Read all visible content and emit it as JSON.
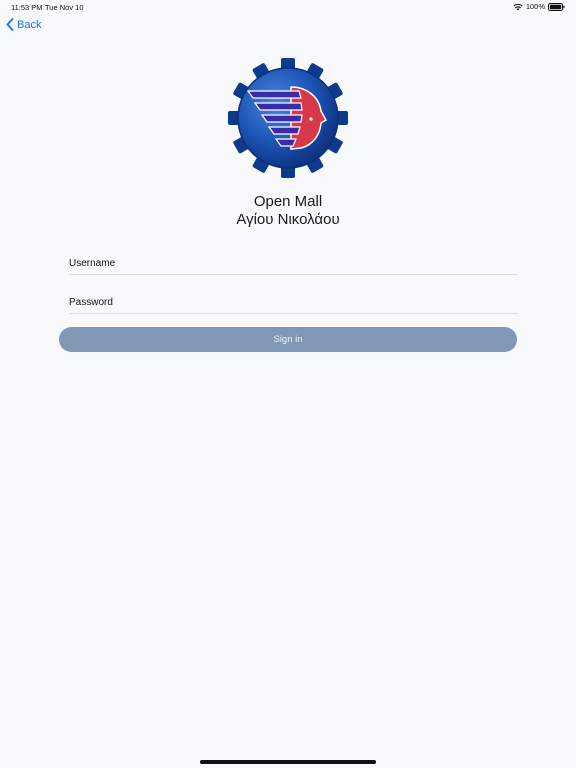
{
  "status_bar": {
    "time": "11:53 PM",
    "date": "Tue Nov 10",
    "battery": "100%",
    "icons": [
      "wifi-icon",
      "battery-icon"
    ]
  },
  "nav": {
    "back_label": "Back",
    "back_icon": "chevron-left-icon"
  },
  "logo": {
    "icon": "gear-logo-icon",
    "colors": {
      "gear": "#1d56b6",
      "wing": "#3d2aa8",
      "face": "#d8394a"
    }
  },
  "app_title": {
    "line1": "Open Mall",
    "line2": "Αγίου Νικολάου"
  },
  "form": {
    "username_placeholder": "Username",
    "password_placeholder": "Password",
    "signin_label": "Sign in"
  },
  "colors": {
    "background": "#f7f9fb",
    "accent": "#1f6feb",
    "button": "#8097b6"
  }
}
